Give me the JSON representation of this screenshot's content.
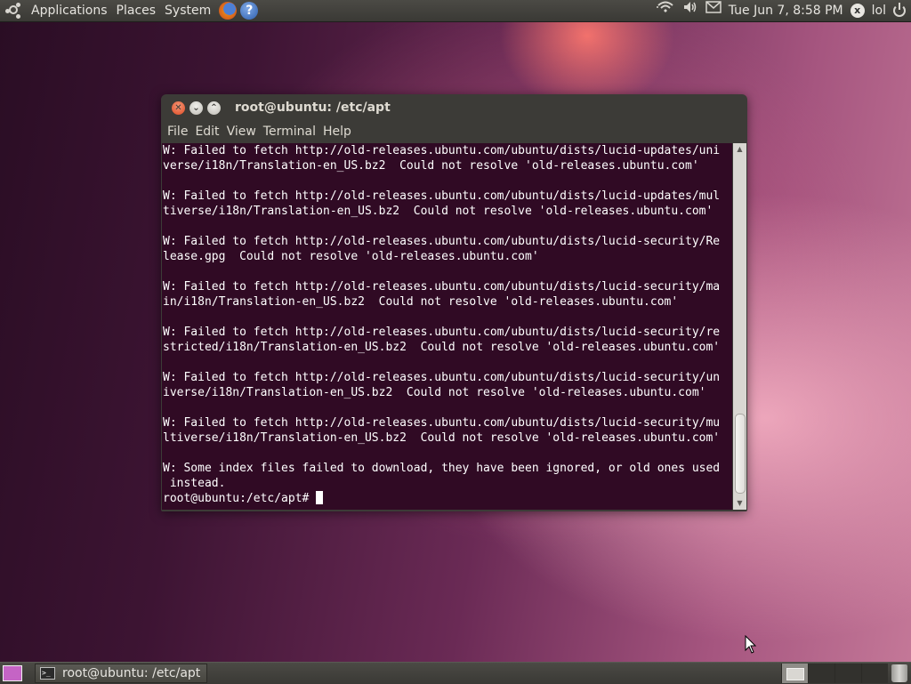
{
  "top_panel": {
    "menus": [
      "Applications",
      "Places",
      "System"
    ],
    "clock": "Tue Jun  7,  8:58 PM",
    "username": "lol",
    "user_initial": "x",
    "help_glyph": "?"
  },
  "terminal": {
    "title": "root@ubuntu: /etc/apt",
    "menu": [
      "File",
      "Edit",
      "View",
      "Terminal",
      "Help"
    ],
    "lines": [
      "W: Failed to fetch http://old-releases.ubuntu.com/ubuntu/dists/lucid-updates/uni",
      "verse/i18n/Translation-en_US.bz2  Could not resolve 'old-releases.ubuntu.com'",
      "",
      "W: Failed to fetch http://old-releases.ubuntu.com/ubuntu/dists/lucid-updates/mul",
      "tiverse/i18n/Translation-en_US.bz2  Could not resolve 'old-releases.ubuntu.com'",
      "",
      "W: Failed to fetch http://old-releases.ubuntu.com/ubuntu/dists/lucid-security/Re",
      "lease.gpg  Could not resolve 'old-releases.ubuntu.com'",
      "",
      "W: Failed to fetch http://old-releases.ubuntu.com/ubuntu/dists/lucid-security/ma",
      "in/i18n/Translation-en_US.bz2  Could not resolve 'old-releases.ubuntu.com'",
      "",
      "W: Failed to fetch http://old-releases.ubuntu.com/ubuntu/dists/lucid-security/re",
      "stricted/i18n/Translation-en_US.bz2  Could not resolve 'old-releases.ubuntu.com'",
      "",
      "W: Failed to fetch http://old-releases.ubuntu.com/ubuntu/dists/lucid-security/un",
      "iverse/i18n/Translation-en_US.bz2  Could not resolve 'old-releases.ubuntu.com'",
      "",
      "W: Failed to fetch http://old-releases.ubuntu.com/ubuntu/dists/lucid-security/mu",
      "ltiverse/i18n/Translation-en_US.bz2  Could not resolve 'old-releases.ubuntu.com'",
      "",
      "W: Some index files failed to download, they have been ignored, or old ones used",
      " instead."
    ],
    "prompt": "root@ubuntu:/etc/apt# "
  },
  "bottom_panel": {
    "task_label": "root@ubuntu: /etc/apt"
  },
  "icons": {
    "top_left": "ubuntu-logo-icon",
    "launchers": [
      "firefox-icon",
      "help-icon"
    ],
    "tray": [
      "network-icon",
      "volume-icon",
      "mail-icon",
      "user-icon",
      "power-icon"
    ],
    "bottom": [
      "show-desktop-icon",
      "terminal-icon",
      "trash-icon"
    ]
  }
}
